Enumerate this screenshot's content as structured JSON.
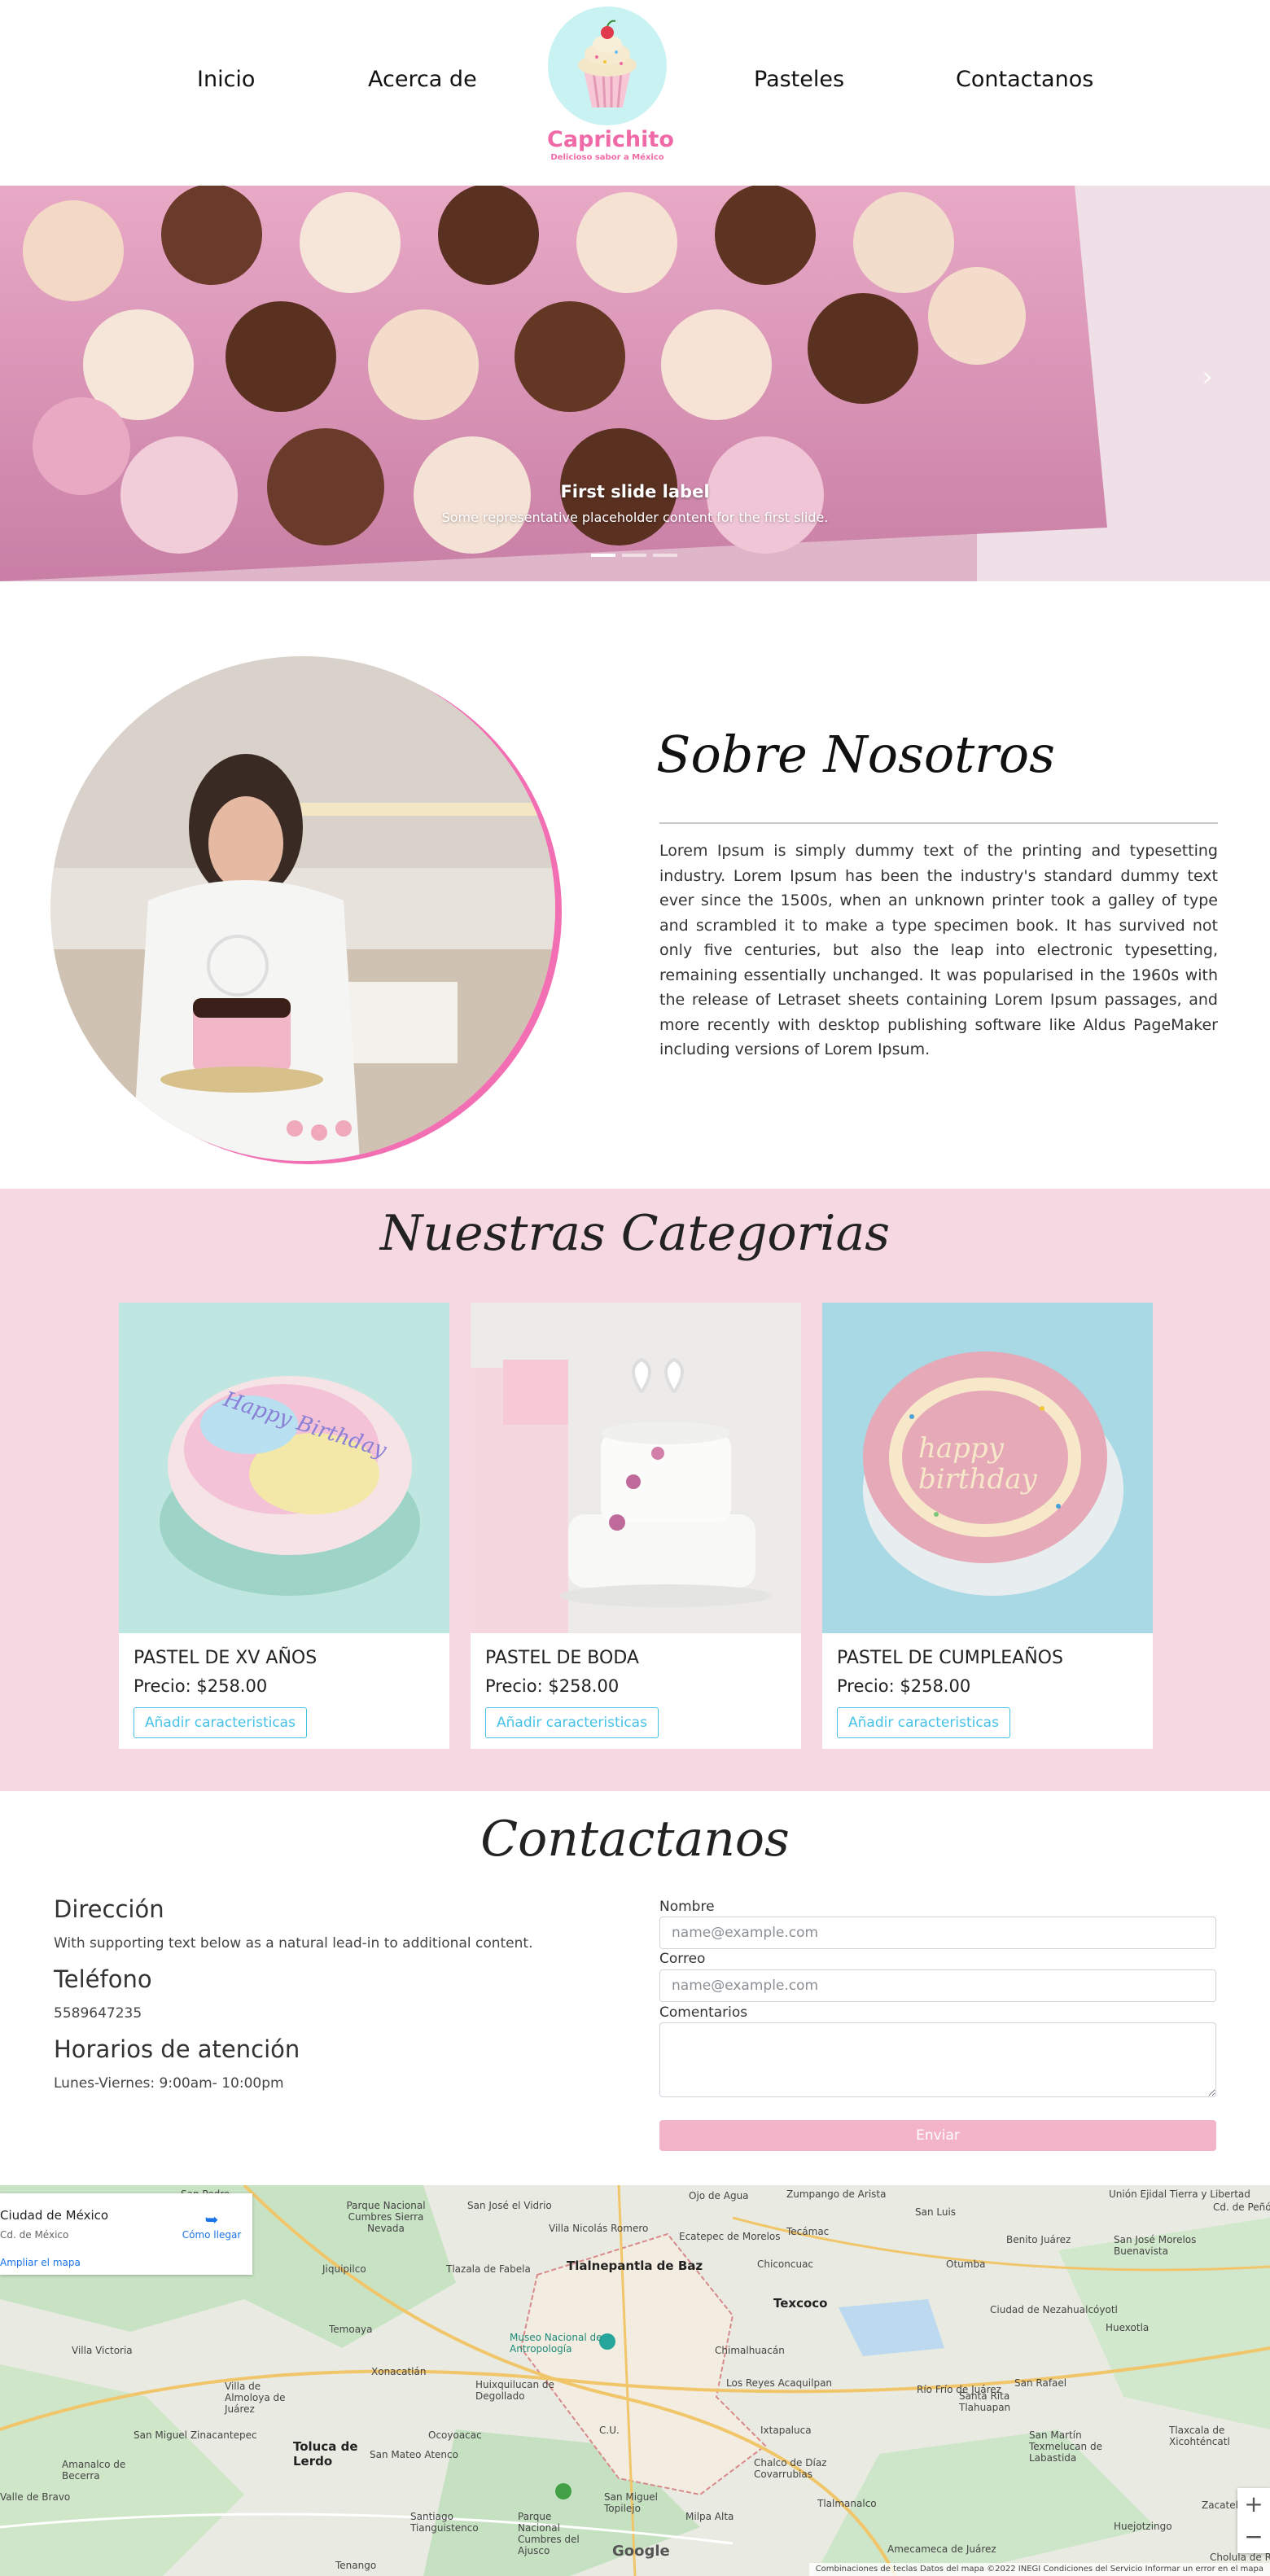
{
  "nav": {
    "links": [
      "Inicio",
      "Acerca de",
      "Pasteles",
      "Contactanos"
    ],
    "logo_name": "Caprichito",
    "logo_tagline": "Delicioso sabor a México"
  },
  "carousel": {
    "caption_title": "First slide label",
    "caption_text": "Some representative placeholder content for the first slide.",
    "slide_count": 3,
    "active_slide": 1
  },
  "about": {
    "title": "Sobre Nosotros",
    "text": "Lorem Ipsum is simply dummy text of the printing and typesetting industry. Lorem Ipsum has been the industry's standard dummy text ever since the 1500s, when an unknown printer took a galley of type and scrambled it to make a type specimen book. It has survived not only five centuries, but also the leap into electronic typesetting, remaining essentially unchanged. It was popularised in the 1960s with the release of Letraset sheets containing Lorem Ipsum passages, and more recently with desktop publishing software like Aldus PageMaker including versions of Lorem Ipsum."
  },
  "categories": {
    "title": "Nuestras Categorias",
    "cards": [
      {
        "title": "PASTEL DE XV AÑOS",
        "price": "Precio: $258.00",
        "button": "Añadir caracteristicas"
      },
      {
        "title": "PASTEL DE BODA",
        "price": "Precio: $258.00",
        "button": "Añadir caracteristicas"
      },
      {
        "title": "PASTEL DE CUMPLEAÑOS",
        "price": "Precio: $258.00",
        "button": "Añadir caracteristicas"
      }
    ]
  },
  "contact": {
    "title": "Contactanos",
    "address_heading": "Dirección",
    "address_text": "With supporting text below as a natural lead-in to additional content.",
    "phone_heading": "Teléfono",
    "phone_text": "5589647235",
    "hours_heading": "Horarios de atención",
    "hours_text": "Lunes-Viernes: 9:00am- 10:00pm",
    "form": {
      "name_label": "Nombre",
      "name_placeholder": "name@example.com",
      "email_label": "Correo",
      "email_placeholder": "name@example.com",
      "comments_label": "Comentarios",
      "submit": "Enviar"
    }
  },
  "map": {
    "card_title": "Ciudad de México",
    "card_sub": "Cd. de México",
    "card_link": "Ampliar el mapa",
    "card_directions": "Cómo llegar",
    "footer": "Combinaciones de teclas    Datos del mapa ©2022 INEGI    Condiciones del Servicio    Informar un error en el mapa",
    "brand": "Google",
    "labels": [
      "San Pedro",
      "Parque Nacional Cumbres Sierra Nevada",
      "San José el Vidrio",
      "Villa Nicolás Romero",
      "Tlalnepantla de Baz",
      "Ecatepec de Morelos",
      "Tecámac",
      "Zumpango de Arista",
      "Unión Ejidal Tierra y Libertad",
      "Cd. de Peñón",
      "Jiquipilco",
      "Tlazala de Fabela",
      "Ojo de Agua",
      "San Luis",
      "Benito Juárez",
      "San José Morelos Buenavista",
      "Otumba",
      "Temoaya",
      "Museo Nacional de Antropología",
      "Texcoco",
      "Chiconcuac",
      "Ciudad de Nezahualcóyotl",
      "Huexotla",
      "Chimalhuacán",
      "Los Reyes Acaquilpan",
      "Villa Victoria",
      "Xonacatlán",
      "Huixquilucan de Degollado",
      "Villa de Almoloya de Juárez",
      "Ocoyoacac",
      "San Miguel Zinacantepec",
      "Toluca de Lerdo",
      "San Mateo Atenco",
      "C.U.",
      "Ixtapaluca",
      "Río Frío de Juárez",
      "San Rafael",
      "Tlaxcala de Xicohténcatl",
      "Santa Rita Tlahuapan",
      "Chalco de Díaz Covarrubias",
      "San Martín Texmelucan de Labastida",
      "Amanalco de Becerra",
      "Santiago Tianguistenco",
      "Parque Nacional Cumbres del Ajusco",
      "Tlalmanalco",
      "San Miguel Topilejo",
      "Milpa Alta",
      "Amecameca de Juárez",
      "Huejotzingo",
      "Zacatelco",
      "Valle de Bravo",
      "Tenango",
      "Cholula de Rivadavia"
    ]
  }
}
